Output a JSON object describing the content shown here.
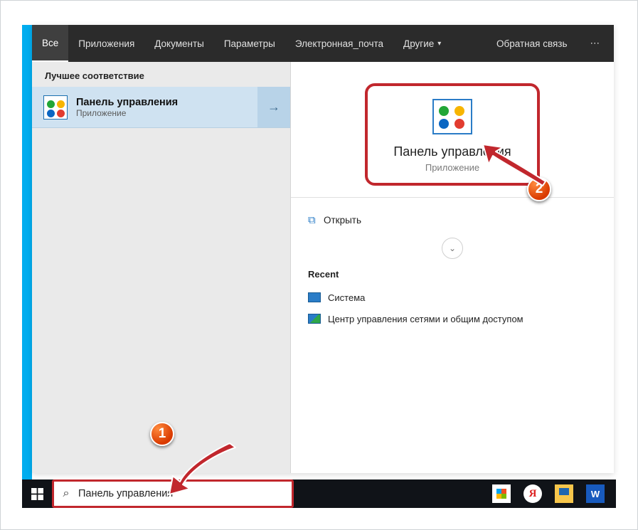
{
  "tabs": {
    "all": "Все",
    "apps": "Приложения",
    "docs": "Документы",
    "settings": "Параметры",
    "email": "Электронная_почта",
    "more": "Другие",
    "feedback": "Обратная связь"
  },
  "left": {
    "best_match": "Лучшее соответствие",
    "result_title": "Панель управления",
    "result_sub": "Приложение"
  },
  "preview": {
    "title": "Панель управления",
    "sub": "Приложение"
  },
  "actions": {
    "open": "Открыть"
  },
  "recent": {
    "header": "Recent",
    "items": [
      {
        "label": "Система"
      },
      {
        "label": "Центр управления сетями и общим доступом"
      }
    ]
  },
  "search": {
    "value": "Панель управления"
  },
  "badges": {
    "one": "1",
    "two": "2"
  },
  "tb": {
    "y": "Я",
    "w": "W"
  }
}
